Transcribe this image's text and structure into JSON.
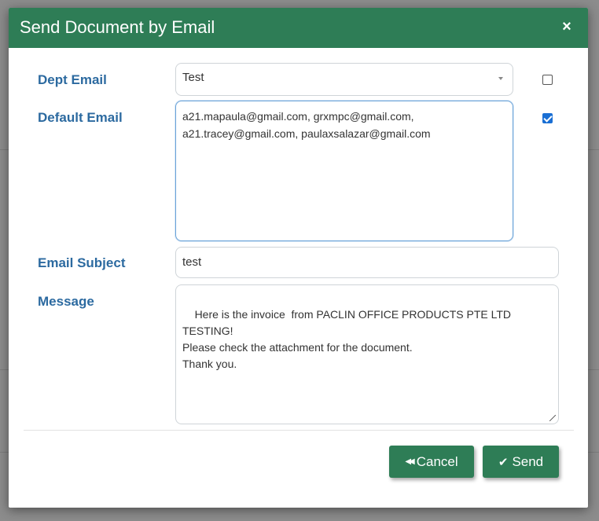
{
  "dialog": {
    "title": "Send Document by Email",
    "close_symbol": "×"
  },
  "form": {
    "dept_email": {
      "label": "Dept Email",
      "value": "Test",
      "checked": false
    },
    "default_email": {
      "label": "Default Email",
      "value": "a21.mapaula@gmail.com, grxmpc@gmail.com,\na21.tracey@gmail.com, paulaxsalazar@gmail.com",
      "checked": true
    },
    "email_subject": {
      "label": "Email Subject",
      "value": "test"
    },
    "message": {
      "label": "Message",
      "value": "Here is the invoice  from PACLIN OFFICE PRODUCTS PTE LTD TESTING!\nPlease check the attachment for the document.\nThank you."
    }
  },
  "buttons": {
    "cancel": {
      "label": "Cancel",
      "icon": "double-chevron-left-icon"
    },
    "send": {
      "label": "Send",
      "icon": "check-icon"
    }
  },
  "colors": {
    "header": "#2e7d56",
    "label": "#2c6aa0",
    "checkbox_checked": "#1a6fd4"
  }
}
